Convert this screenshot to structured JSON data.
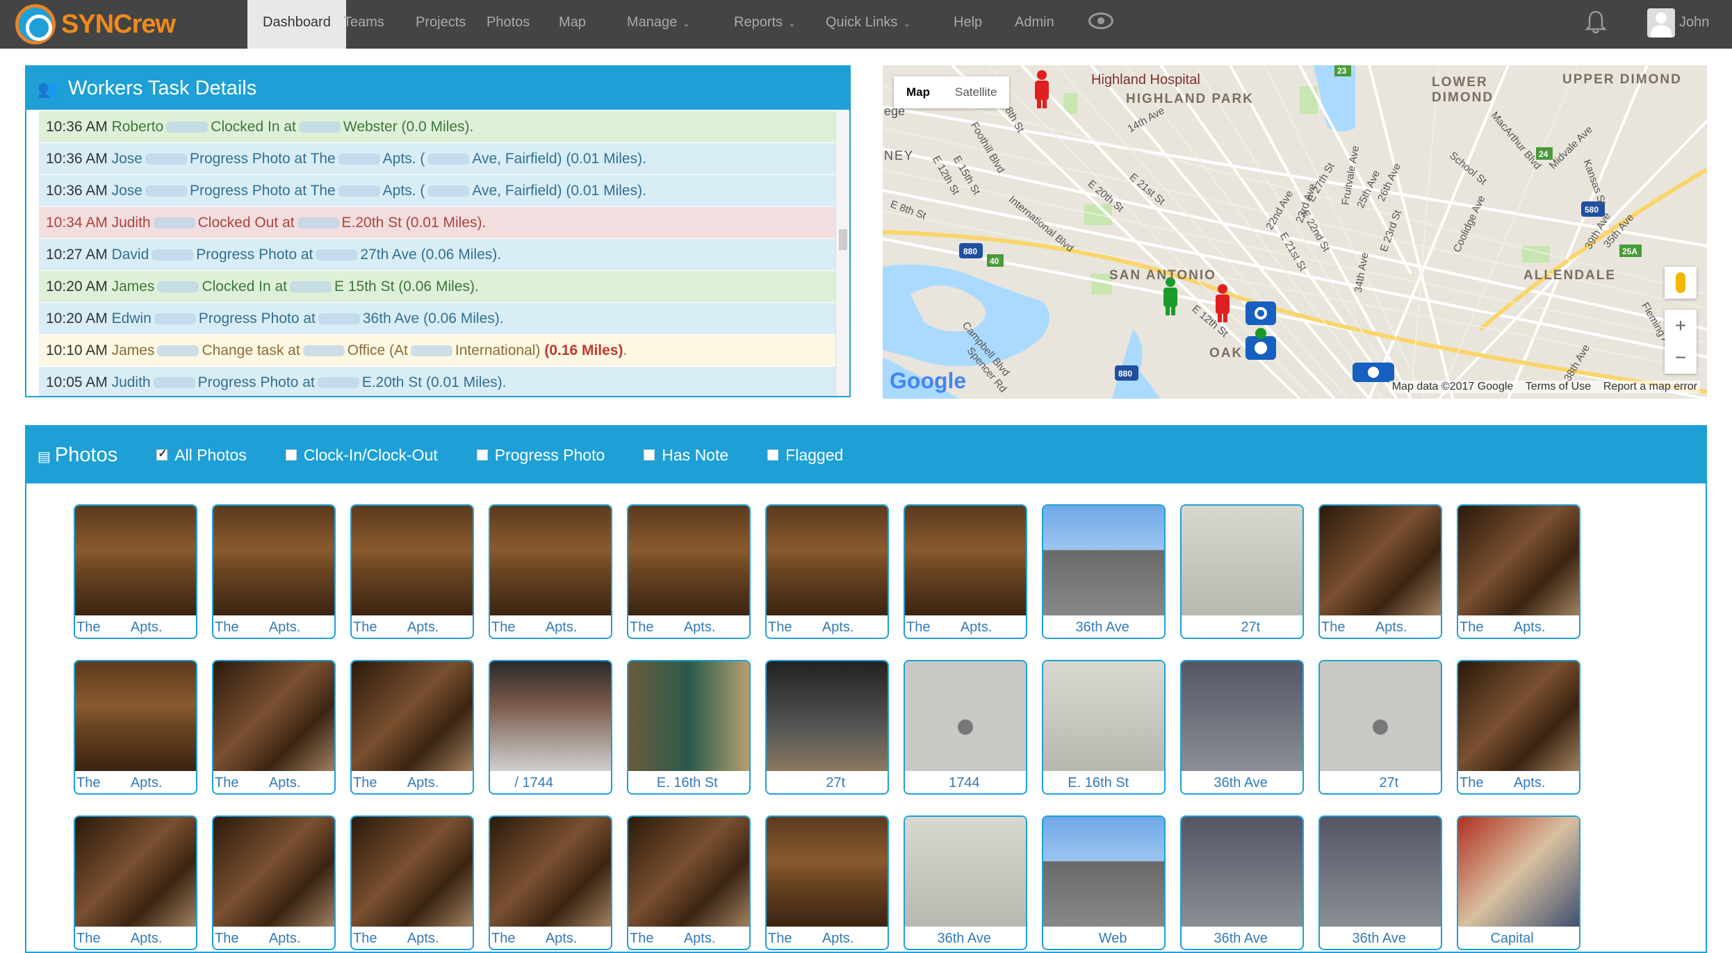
{
  "brand": {
    "name": "SYNCrew"
  },
  "nav": {
    "items": [
      {
        "label": "Dashboard",
        "active": true,
        "caret": false
      },
      {
        "label": "Teams",
        "caret": false
      },
      {
        "label": "Projects",
        "caret": false
      },
      {
        "label": "Photos",
        "caret": false
      },
      {
        "label": "Map",
        "caret": false
      },
      {
        "label": "Manage",
        "caret": true
      },
      {
        "label": "Reports",
        "caret": true
      },
      {
        "label": "Quick Links",
        "caret": true
      },
      {
        "label": "Help",
        "caret": false
      },
      {
        "label": "Admin",
        "caret": false
      }
    ],
    "user": "John"
  },
  "workers": {
    "title": "Workers Task Details",
    "tasks": [
      {
        "color": "green",
        "time": "10:36 AM",
        "name": "Roberto",
        "action": "Clocked In at",
        "place": "Webster",
        "distance": "(0.0 Miles)."
      },
      {
        "color": "blue",
        "time": "10:36 AM",
        "name": "Jose",
        "action": "Progress Photo at The",
        "place": "Apts. (",
        "place2": "Ave, Fairfield)",
        "distance": "(0.01 Miles)."
      },
      {
        "color": "blue",
        "time": "10:36 AM",
        "name": "Jose",
        "action": "Progress Photo at The",
        "place": "Apts. (",
        "place2": "Ave, Fairfield)",
        "distance": "(0.01 Miles)."
      },
      {
        "color": "red",
        "time": "10:34 AM",
        "name": "Judith",
        "action": "Clocked Out at",
        "place": "E.20th St",
        "distance": "(0.01 Miles)."
      },
      {
        "color": "blue",
        "time": "10:27 AM",
        "name": "David",
        "action": "Progress Photo at",
        "place": "27th Ave",
        "distance": "(0.06 Miles)."
      },
      {
        "color": "green",
        "time": "10:20 AM",
        "name": "James",
        "action": "Clocked In at",
        "place": "E 15th St",
        "distance": "(0.06 Miles)."
      },
      {
        "color": "blue",
        "time": "10:20 AM",
        "name": "Edwin",
        "action": "Progress Photo at",
        "place": "36th Ave",
        "distance": "(0.06 Miles)."
      },
      {
        "color": "yellow",
        "time": "10:10 AM",
        "name": "James",
        "action": "Change task at",
        "place": "Office (At",
        "place2": "International)",
        "distance_warn": "(0.16 Miles)",
        "end": "."
      },
      {
        "color": "blue",
        "time": "10:05 AM",
        "name": "Judith",
        "action": "Progress Photo at",
        "place": "E.20th St",
        "distance": "(0.01 Miles)."
      }
    ]
  },
  "map": {
    "type_map": "Map",
    "type_satellite": "Satellite",
    "labels": {
      "highland_hospital": "Highland Hospital",
      "highland_park": "HIGHLAND PARK",
      "lower_dimond": "LOWER\nDIMOND",
      "upper_dimond": "UPPER DIMOND",
      "san_antonio": "SAN ANTONIO",
      "allendale": "ALLENDALE",
      "oak": "OAK",
      "ney": "NEY",
      "ege": "ege"
    },
    "streets": [
      "14th Ave",
      "Foothill Blvd",
      "E 15th St",
      "8th St",
      "E 12th St",
      "E 8th St",
      "International Blvd",
      "E 20th St",
      "E 21st St",
      "22nd Ave",
      "E 27th St",
      "Fruitvale Ave",
      "School St",
      "MacArthur Blvd",
      "Midvale Ave",
      "Kansas St",
      "39th Ave",
      "Coolidge Ave",
      "35th Ave",
      "34th Ave",
      "Campbell Blvd",
      "Spencer Rd",
      "38th Ave",
      "Fleming Ave",
      "E 23rd St",
      "26th Ave",
      "25th Ave",
      "E 22nd St",
      "E 21st St",
      "23rd Ave",
      "E 12th St"
    ],
    "highways": [
      "880",
      "40",
      "23",
      "24",
      "580",
      "25A",
      "880"
    ],
    "zoom_in": "+",
    "zoom_out": "−",
    "google": "Google",
    "attribution": "Map data ©2017 Google",
    "terms": "Terms of Use",
    "report": "Report a map error"
  },
  "photos": {
    "title": "Photos",
    "filters": [
      {
        "label": "All Photos",
        "checked": true
      },
      {
        "label": "Clock-In/Clock-Out",
        "checked": false
      },
      {
        "label": "Progress Photo",
        "checked": false
      },
      {
        "label": "Has Note",
        "checked": false
      },
      {
        "label": "Flagged",
        "checked": false
      }
    ],
    "items": [
      {
        "caption": "The        Apts.",
        "style": "wood"
      },
      {
        "caption": "The        Apts.",
        "style": "wood"
      },
      {
        "caption": "The        Apts.",
        "style": "wood"
      },
      {
        "caption": "The        Apts.",
        "style": "wood"
      },
      {
        "caption": "The        Apts.",
        "style": "wood"
      },
      {
        "caption": "The        Apts.",
        "style": "wood"
      },
      {
        "caption": "The        Apts.",
        "style": "wood"
      },
      {
        "caption": "        36th Ave",
        "style": "sky"
      },
      {
        "caption": "               27t",
        "style": "wall"
      },
      {
        "caption": "The        Apts.",
        "style": "wood2"
      },
      {
        "caption": "The        Apts.",
        "style": "wood2"
      },
      {
        "caption": "The        Apts.",
        "style": "wood"
      },
      {
        "caption": "The        Apts.",
        "style": "wood2"
      },
      {
        "caption": "The        Apts.",
        "style": "wood2"
      },
      {
        "caption": "      / 1744",
        "style": "roof"
      },
      {
        "caption": "       E. 16th St",
        "style": "room"
      },
      {
        "caption": "               27t",
        "style": "dark"
      },
      {
        "caption": "           1744",
        "style": "sink"
      },
      {
        "caption": "      E. 16th St",
        "style": "wall"
      },
      {
        "caption": "        36th Ave",
        "style": "bldg"
      },
      {
        "caption": "               27t",
        "style": "sink"
      },
      {
        "caption": "The        Apts.",
        "style": "wood2"
      },
      {
        "caption": "The        Apts.",
        "style": "wood2"
      },
      {
        "caption": "The        Apts.",
        "style": "wood2"
      },
      {
        "caption": "The        Apts.",
        "style": "wood2"
      },
      {
        "caption": "The        Apts.",
        "style": "wood2"
      },
      {
        "caption": "The        Apts.",
        "style": "wood2"
      },
      {
        "caption": "The        Apts.",
        "style": "wood"
      },
      {
        "caption": "        36th Ave",
        "style": "wall"
      },
      {
        "caption": "              Web",
        "style": "sky"
      },
      {
        "caption": "        36th Ave",
        "style": "bldg"
      },
      {
        "caption": "        36th Ave",
        "style": "bldg"
      },
      {
        "caption": "        Capital",
        "style": "news"
      }
    ]
  },
  "colors": {
    "accent": "#1ea0d6",
    "nav_bg": "#444444",
    "brand": "#f08a1c",
    "warn": "#c0392b"
  }
}
